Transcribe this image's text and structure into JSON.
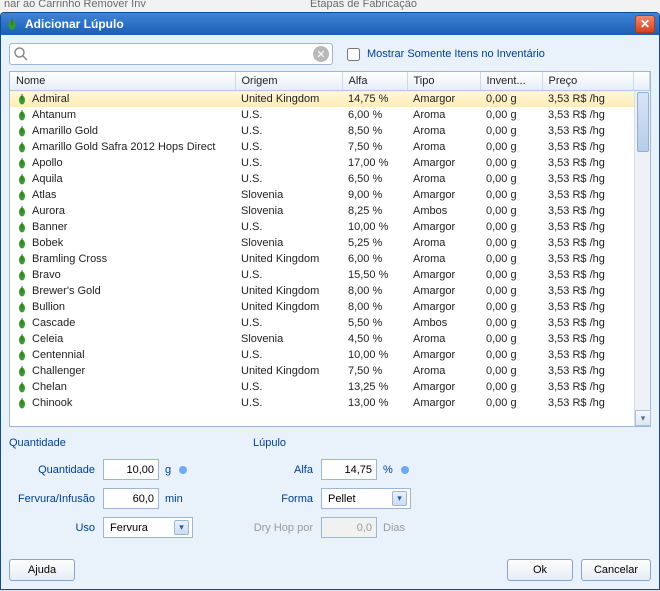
{
  "behind": {
    "left": "nar ao Carrinho   Remover Inv",
    "right": "Etapas de Fabricação"
  },
  "window": {
    "title": "Adicionar Lúpulo"
  },
  "search": {
    "value": "",
    "placeholder": ""
  },
  "inventory_only": {
    "label": "Mostrar Somente Itens no Inventário",
    "checked": false
  },
  "columns": [
    "Nome",
    "Origem",
    "Alfa",
    "Tipo",
    "Invent...",
    "Preço"
  ],
  "rows": [
    {
      "name": "Admiral",
      "origin": "United Kingdom",
      "alpha": "14,75 %",
      "type": "Amargor",
      "inv": "0,00 g",
      "price": "3,53 R$ /hg",
      "selected": true
    },
    {
      "name": "Ahtanum",
      "origin": "U.S.",
      "alpha": "6,00 %",
      "type": "Aroma",
      "inv": "0,00 g",
      "price": "3,53 R$ /hg"
    },
    {
      "name": "Amarillo Gold",
      "origin": "U.S.",
      "alpha": "8,50 %",
      "type": "Aroma",
      "inv": "0,00 g",
      "price": "3,53 R$ /hg"
    },
    {
      "name": "Amarillo Gold Safra 2012 Hops Direct",
      "origin": "U.S.",
      "alpha": "7,50 %",
      "type": "Aroma",
      "inv": "0,00 g",
      "price": "3,53 R$ /hg"
    },
    {
      "name": "Apollo",
      "origin": "U.S.",
      "alpha": "17,00 %",
      "type": "Amargor",
      "inv": "0,00 g",
      "price": "3,53 R$ /hg"
    },
    {
      "name": "Aquila",
      "origin": "U.S.",
      "alpha": "6,50 %",
      "type": "Aroma",
      "inv": "0,00 g",
      "price": "3,53 R$ /hg"
    },
    {
      "name": "Atlas",
      "origin": "Slovenia",
      "alpha": "9,00 %",
      "type": "Amargor",
      "inv": "0,00 g",
      "price": "3,53 R$ /hg"
    },
    {
      "name": "Aurora",
      "origin": "Slovenia",
      "alpha": "8,25 %",
      "type": "Ambos",
      "inv": "0,00 g",
      "price": "3,53 R$ /hg"
    },
    {
      "name": "Banner",
      "origin": "U.S.",
      "alpha": "10,00 %",
      "type": "Amargor",
      "inv": "0,00 g",
      "price": "3,53 R$ /hg"
    },
    {
      "name": "Bobek",
      "origin": "Slovenia",
      "alpha": "5,25 %",
      "type": "Aroma",
      "inv": "0,00 g",
      "price": "3,53 R$ /hg"
    },
    {
      "name": "Bramling Cross",
      "origin": "United Kingdom",
      "alpha": "6,00 %",
      "type": "Aroma",
      "inv": "0,00 g",
      "price": "3,53 R$ /hg"
    },
    {
      "name": "Bravo",
      "origin": "U.S.",
      "alpha": "15,50 %",
      "type": "Amargor",
      "inv": "0,00 g",
      "price": "3,53 R$ /hg"
    },
    {
      "name": "Brewer's Gold",
      "origin": "United Kingdom",
      "alpha": "8,00 %",
      "type": "Amargor",
      "inv": "0,00 g",
      "price": "3,53 R$ /hg"
    },
    {
      "name": "Bullion",
      "origin": "United Kingdom",
      "alpha": "8,00 %",
      "type": "Amargor",
      "inv": "0,00 g",
      "price": "3,53 R$ /hg"
    },
    {
      "name": "Cascade",
      "origin": "U.S.",
      "alpha": "5,50 %",
      "type": "Ambos",
      "inv": "0,00 g",
      "price": "3,53 R$ /hg"
    },
    {
      "name": "Celeia",
      "origin": "Slovenia",
      "alpha": "4,50 %",
      "type": "Aroma",
      "inv": "0,00 g",
      "price": "3,53 R$ /hg"
    },
    {
      "name": "Centennial",
      "origin": "U.S.",
      "alpha": "10,00 %",
      "type": "Amargor",
      "inv": "0,00 g",
      "price": "3,53 R$ /hg"
    },
    {
      "name": "Challenger",
      "origin": "United Kingdom",
      "alpha": "7,50 %",
      "type": "Aroma",
      "inv": "0,00 g",
      "price": "3,53 R$ /hg"
    },
    {
      "name": "Chelan",
      "origin": "U.S.",
      "alpha": "13,25 %",
      "type": "Amargor",
      "inv": "0,00 g",
      "price": "3,53 R$ /hg"
    },
    {
      "name": "Chinook",
      "origin": "U.S.",
      "alpha": "13,00 %",
      "type": "Amargor",
      "inv": "0,00 g",
      "price": "3,53 R$ /hg"
    }
  ],
  "form": {
    "group_qty_label": "Quantidade",
    "group_hop_label": "Lúpulo",
    "qty_label": "Quantidade",
    "qty_value": "10,00",
    "qty_unit": "g",
    "boil_label": "Fervura/Infusão",
    "boil_value": "60,0",
    "boil_unit": "min",
    "use_label": "Uso",
    "use_value": "Fervura",
    "alpha_label": "Alfa",
    "alpha_value": "14,75",
    "alpha_unit": "%",
    "form_label": "Forma",
    "form_value": "Pellet",
    "dryhop_label": "Dry Hop por",
    "dryhop_value": "0,0",
    "dryhop_unit": "Dias"
  },
  "buttons": {
    "help": "Ajuda",
    "ok": "Ok",
    "cancel": "Cancelar"
  }
}
